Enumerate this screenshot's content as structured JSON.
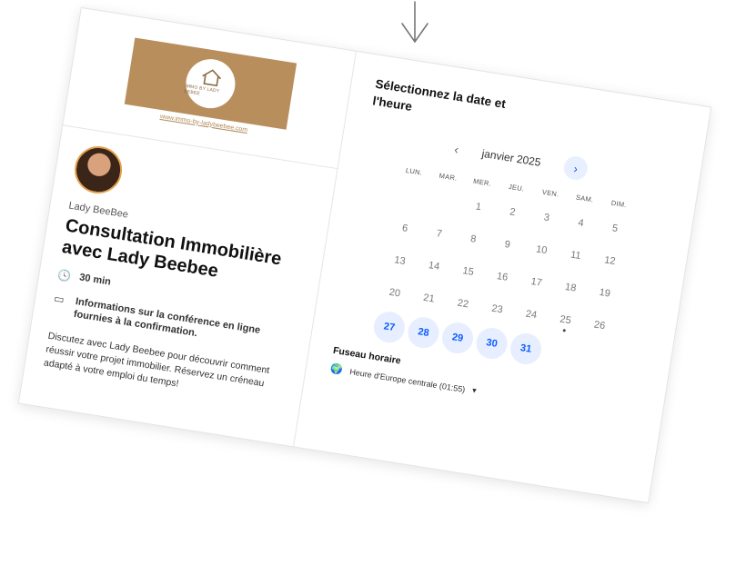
{
  "banner": {
    "logo_text": "IMMO BY LADY BEBEE",
    "link": "www.immo-by-ladybeebee.com"
  },
  "host": "Lady BeeBee",
  "event": {
    "title": "Consultation Immobilière avec Lady Beebee",
    "duration": "30 min",
    "conference": "Informations sur la conférence en ligne fournies à la confirmation.",
    "description": "Discutez avec Lady Beebee pour découvrir comment réussir votre projet immobilier. Réservez un créneau adapté à votre emploi du temps!"
  },
  "calendar": {
    "heading": "Sélectionnez la date et l'heure",
    "month": "janvier 2025",
    "prev": "‹",
    "next": "›",
    "weekdays": [
      "LUN.",
      "MAR.",
      "MER.",
      "JEU.",
      "VEN.",
      "SAM.",
      "DIM."
    ],
    "days": [
      [
        "",
        "",
        "1",
        "2",
        "3",
        "4",
        "5"
      ],
      [
        "6",
        "7",
        "8",
        "9",
        "10",
        "11",
        "12"
      ],
      [
        "13",
        "14",
        "15",
        "16",
        "17",
        "18",
        "19"
      ],
      [
        "20",
        "21",
        "22",
        "23",
        "24",
        "25",
        "26"
      ],
      [
        "27",
        "28",
        "29",
        "30",
        "31",
        "",
        ""
      ]
    ],
    "available": [
      "27",
      "28",
      "29",
      "30",
      "31"
    ],
    "today": "25"
  },
  "timezone": {
    "label": "Fuseau horaire",
    "value": "Heure d'Europe centrale (01:55)",
    "caret": "▾"
  },
  "colors": {
    "accent": "#0a5cff",
    "available_bg": "#e7eeff",
    "banner": "#b88e5c"
  },
  "icons": [
    "arrow-down-icon",
    "clock-icon",
    "video-icon",
    "globe-icon"
  ]
}
